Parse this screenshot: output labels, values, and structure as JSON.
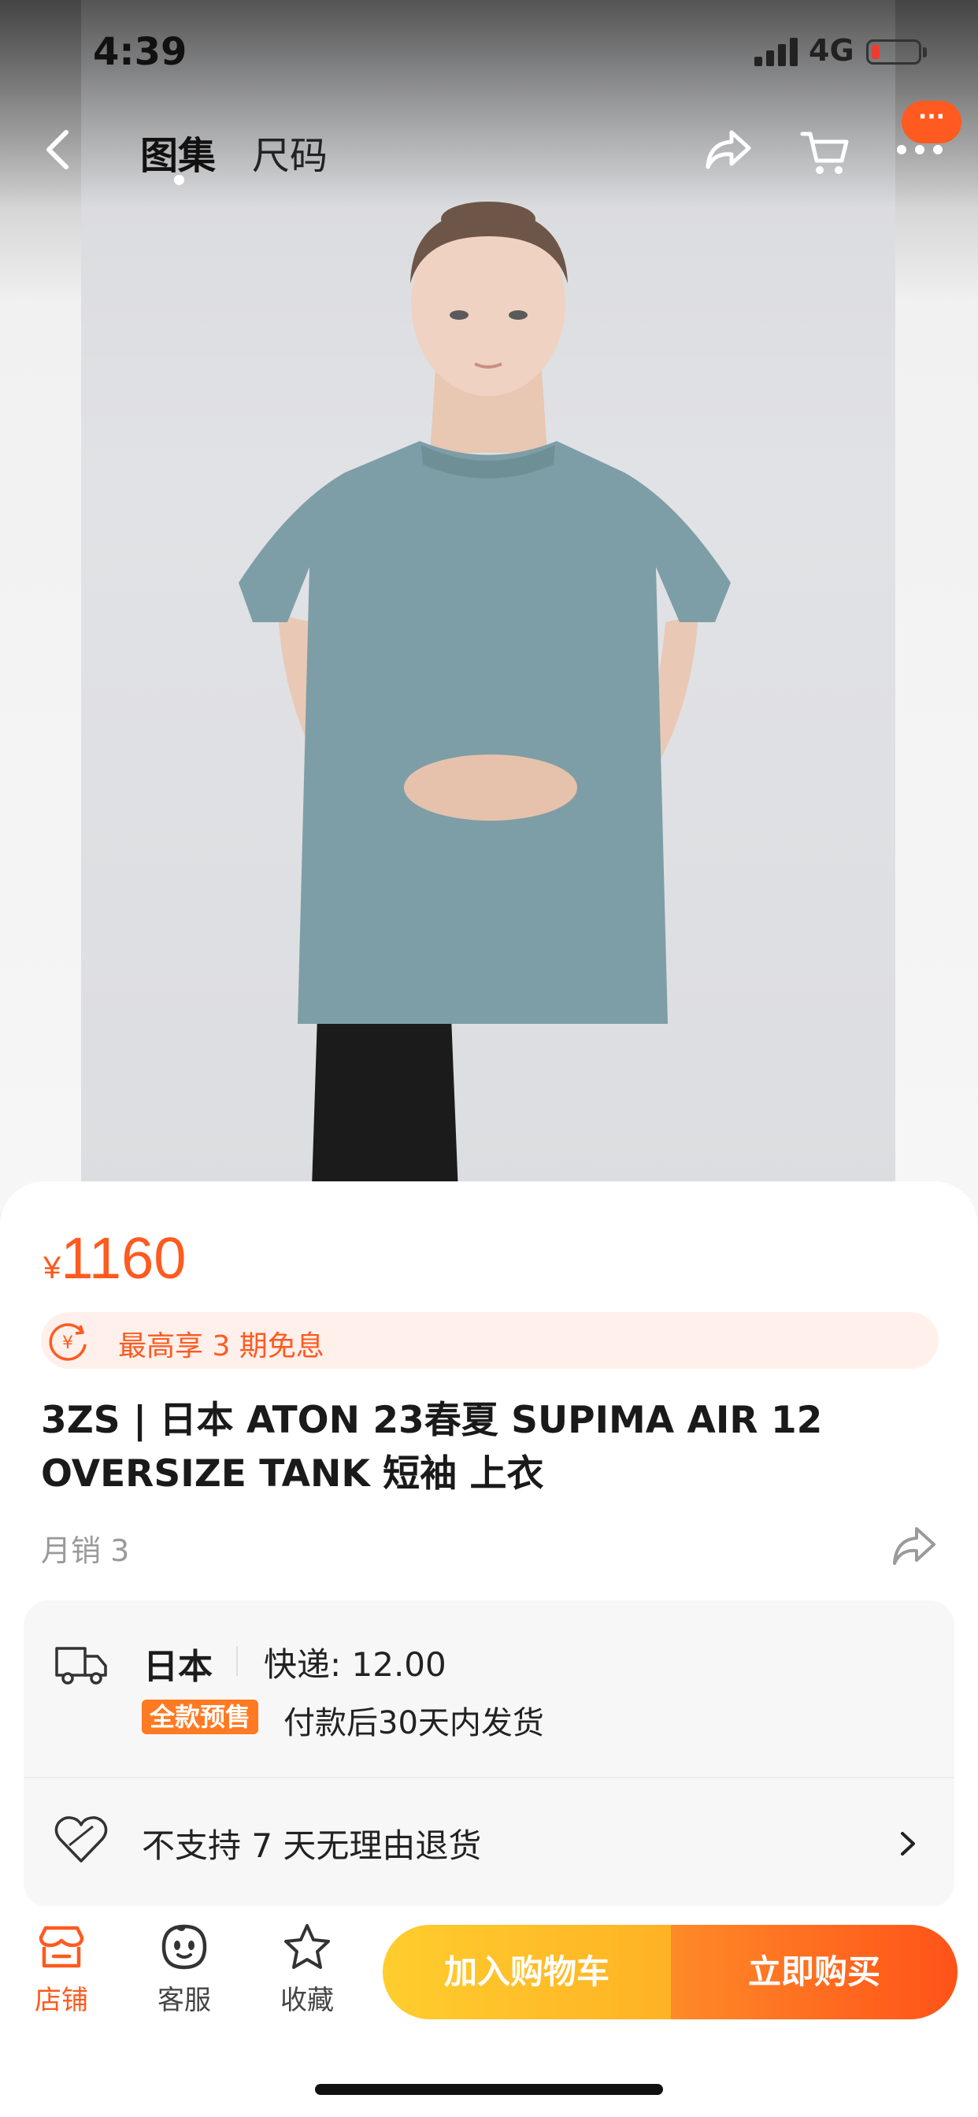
{
  "status_bar": {
    "time": "4:39",
    "network": "4G"
  },
  "nav": {
    "tabs": [
      {
        "label": "图集",
        "active": true
      },
      {
        "label": "尺码",
        "active": false
      }
    ],
    "message_badge": "···"
  },
  "product": {
    "price_symbol": "¥",
    "price": "1160",
    "promo": "最高享 3 期免息",
    "title": "3ZS | 日本 ATON 23春夏 SUPIMA AIR 12 OVERSIZE TANK 短袖 上衣",
    "monthly_sales": "月销 3"
  },
  "shipping": {
    "origin": "日本",
    "express": "快递: 12.00",
    "presale_tag": "全款预售",
    "ship_note": "付款后30天内发货",
    "return_policy": "不支持 7 天无理由退货"
  },
  "bottom_bar": {
    "items": [
      {
        "label": "店铺"
      },
      {
        "label": "客服"
      },
      {
        "label": "收藏"
      }
    ],
    "add_to_cart": "加入购物车",
    "buy_now": "立即购买"
  },
  "colors": {
    "accent": "#ff5a1f",
    "cart_button": "#ffc02a",
    "buy_button": "#ff6a1e"
  }
}
